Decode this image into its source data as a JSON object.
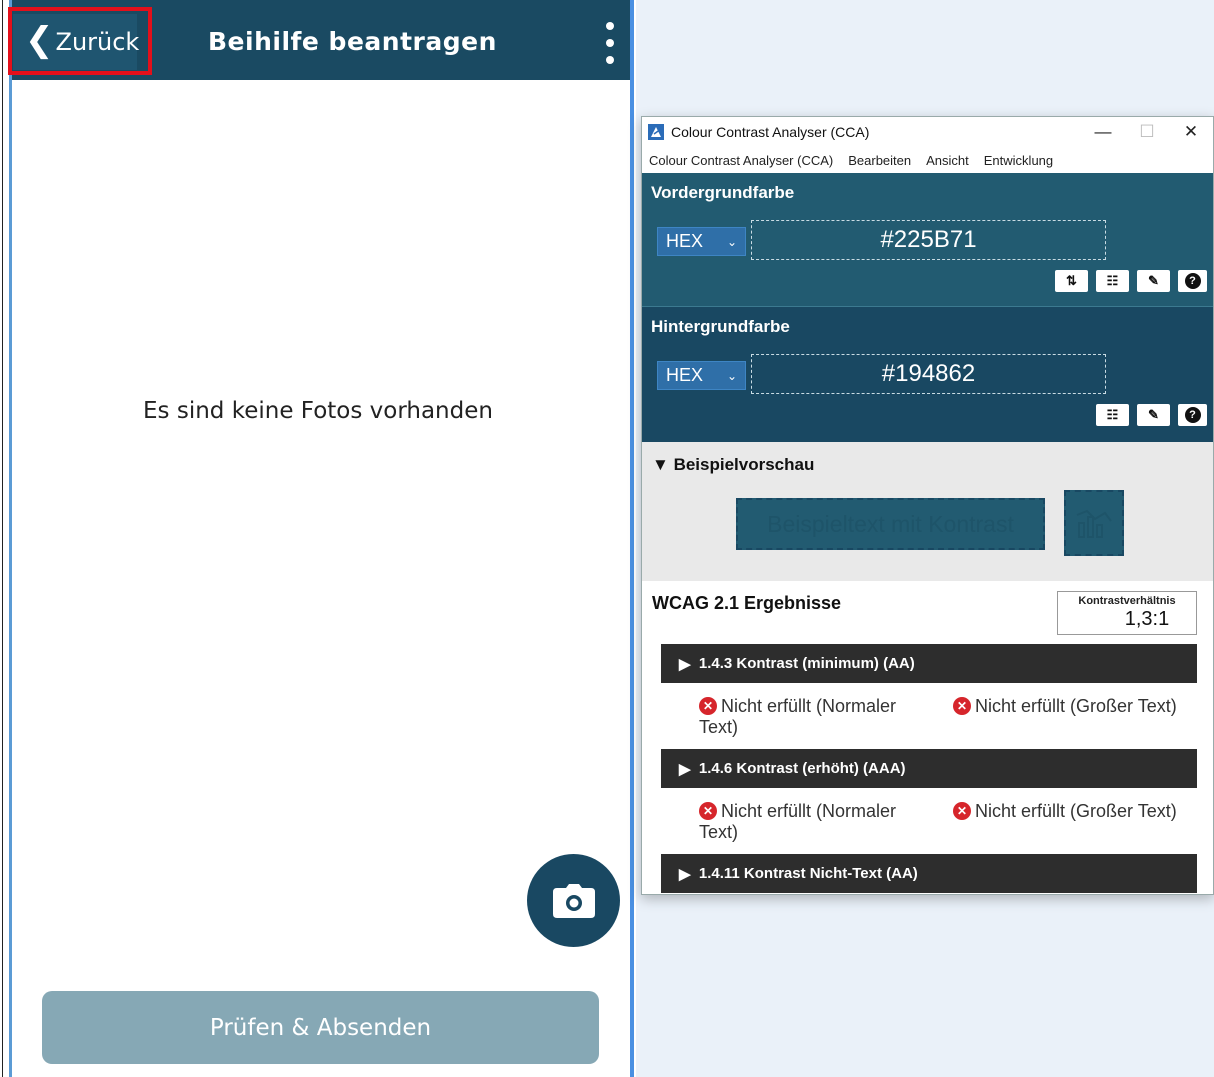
{
  "app": {
    "back_label": "Zurück",
    "title": "Beihilfe beantragen",
    "menu_icon": "more-vertical-icon",
    "empty_message": "Es sind keine Fotos vorhanden",
    "fab_icon": "camera-icon",
    "submit_label": "Prüfen & Absenden",
    "colors": {
      "header": "#1a4a62",
      "fab": "#194862",
      "submit": "#86a8b5",
      "highlight": "#e3101b"
    }
  },
  "cca": {
    "window_title": "Colour Contrast Analyser (CCA)",
    "menu": [
      "Colour Contrast Analyser (CCA)",
      "Bearbeiten",
      "Ansicht",
      "Entwicklung"
    ],
    "foreground": {
      "heading": "Vordergrundfarbe",
      "format": "HEX",
      "value": "#225B71",
      "tools": [
        "swap-icon",
        "sliders-icon",
        "eyedropper-icon",
        "help-icon"
      ]
    },
    "background": {
      "heading": "Hintergrundfarbe",
      "format": "HEX",
      "value": "#194862",
      "tools": [
        "sliders-icon",
        "eyedropper-icon",
        "help-icon"
      ]
    },
    "preview": {
      "heading": "Beispielvorschau",
      "sample_text": "Beispieltext mit Kontrast"
    },
    "results": {
      "heading": "WCAG 2.1 Ergebnisse",
      "ratio_label": "Kontrastverhältnis",
      "ratio_value": "1,3:1",
      "criteria": [
        {
          "title": "1.4.3 Kontrast (minimum) (AA)",
          "normal": "Nicht erfüllt (Normaler Text)",
          "large": "Nicht erfüllt (Großer Text)"
        },
        {
          "title": "1.4.6 Kontrast (erhöht) (AAA)",
          "normal": "Nicht erfüllt (Normaler Text)",
          "large": "Nicht erfüllt (Großer Text)"
        },
        {
          "title": "1.4.11 Kontrast Nicht-Text (AA)"
        }
      ]
    }
  }
}
